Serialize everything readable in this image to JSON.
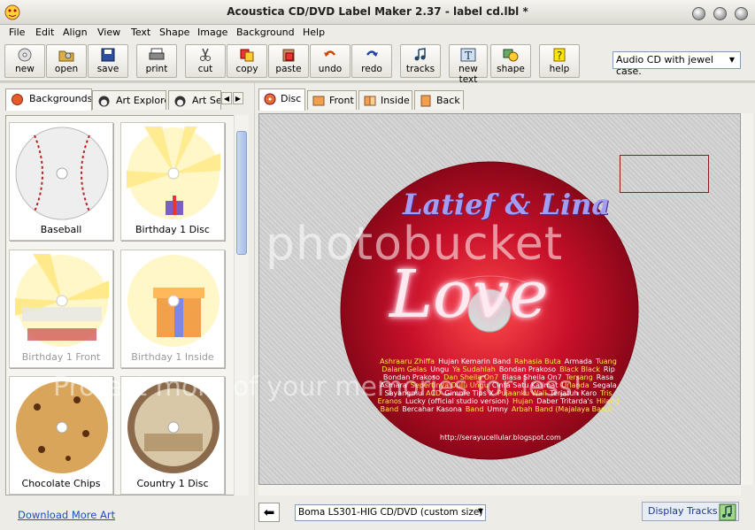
{
  "window": {
    "title": "Acoustica CD/DVD Label Maker 2.37 - label cd.lbl *"
  },
  "menu": [
    "File",
    "Edit",
    "Align",
    "View",
    "Text",
    "Shape",
    "Image",
    "Background",
    "Help"
  ],
  "toolbar": [
    {
      "label": "new",
      "icon": "new-icon"
    },
    {
      "label": "open",
      "icon": "open-icon"
    },
    {
      "label": "save",
      "icon": "save-icon"
    },
    {
      "label": "print",
      "icon": "print-icon"
    },
    {
      "label": "cut",
      "icon": "cut-icon"
    },
    {
      "label": "copy",
      "icon": "copy-icon"
    },
    {
      "label": "paste",
      "icon": "paste-icon"
    },
    {
      "label": "undo",
      "icon": "undo-icon"
    },
    {
      "label": "redo",
      "icon": "redo-icon"
    },
    {
      "label": "tracks",
      "icon": "tracks-icon"
    },
    {
      "label": "new text",
      "icon": "new-text-icon"
    },
    {
      "label": "shape",
      "icon": "shape-icon"
    },
    {
      "label": "help",
      "icon": "help-icon"
    }
  ],
  "case_select": "Audio CD with jewel case.",
  "left_tabs": [
    "Backgrounds",
    "Art Explore",
    "Art Sea"
  ],
  "thumbnails": [
    {
      "label": "Baseball",
      "faded": false
    },
    {
      "label": "Birthday 1 Disc",
      "faded": false
    },
    {
      "label": "Birthday 1 Front",
      "faded": true
    },
    {
      "label": "Birthday 1 Inside",
      "faded": true
    },
    {
      "label": "Chocolate Chips",
      "faded": false
    },
    {
      "label": "Country 1 Disc",
      "faded": false
    }
  ],
  "download_link": "Download More Art",
  "right_tabs": [
    "Disc",
    "Front",
    "Inside",
    "Back"
  ],
  "disc": {
    "title": "Latief & Lina",
    "love": "Love",
    "tracks": [
      "Ashraaru Zhiffa",
      "Hujan Kemarin Band",
      "Rahasia Buta",
      "Armada",
      "Tuang Dalam Gelas",
      "Ungu",
      "Ya Sudahlah",
      "Bondan Prakoso",
      "Black Black",
      "Rip Bondan Prakoso",
      "Dan Sheila On7",
      "Biasa Sheila On7",
      "Tersang",
      "Rasa Asmara",
      "Sepertinya Dulu Ungu",
      "Cinta Satu Kalimat",
      "Urlanda",
      "Segala Sayangmu",
      "ACD",
      "Gimme Tips X",
      "Pujaanku Wali",
      "Terjatuh Karo",
      "Tris Eranos",
      "Lucky (official studio version)",
      "Hujan",
      "Daber Tritarda's",
      "Hilang Band",
      "Bercahar Kasona",
      "Band",
      "Umny",
      "Arbah Band (Majalaya Band)"
    ],
    "url": "http://serayucellular.blogspot.com"
  },
  "paper_select": "Boma LS301-HIG CD/DVD (custom size)",
  "display_tracks": "Display Tracks",
  "watermark": {
    "line1": "photobucket",
    "line2": "Protect more of your memories for less!"
  }
}
